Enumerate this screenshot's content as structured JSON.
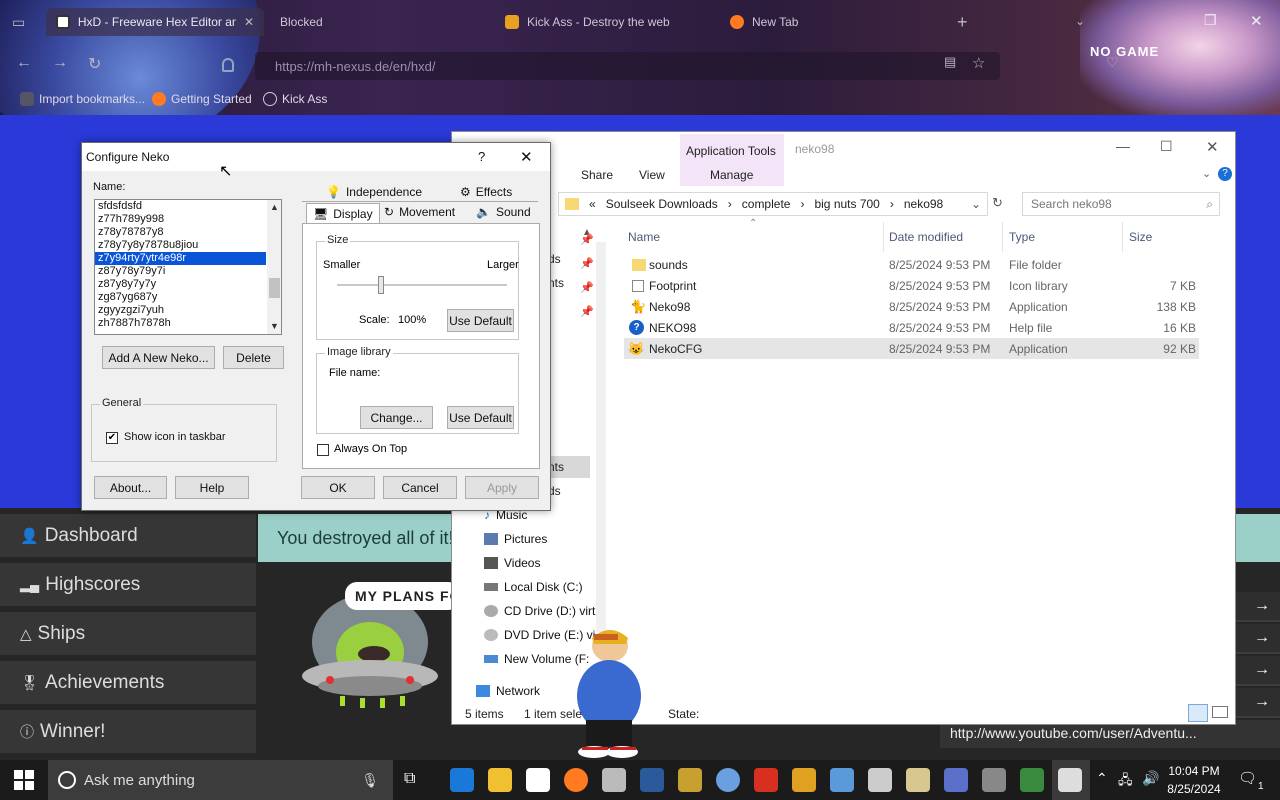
{
  "browser": {
    "tabs": [
      {
        "label": "HxD - Freeware Hex Editor and ..."
      },
      {
        "label": "Blocked"
      },
      {
        "label": "Kick Ass - Destroy the web"
      },
      {
        "label": "New Tab"
      }
    ],
    "url": "https://mh-nexus.de/en/hxd/",
    "bookmarks": [
      "Import bookmarks...",
      "Getting Started",
      "Kick Ass"
    ],
    "theme_text": "NO GAME"
  },
  "site": {
    "sidebar": [
      "Dashboard",
      "Highscores",
      "Ships",
      "Achievements",
      "Winner!"
    ],
    "banner": "You destroyed all of it!",
    "bubble": "MY PLANS FOR",
    "arrows": [
      "→",
      "→",
      "→",
      "→"
    ],
    "link": "http://www.youtube.com/user/Adventu..."
  },
  "explorer": {
    "title": "neko98",
    "ribbon": {
      "context_group": "Application Tools",
      "tabs": [
        "Share",
        "View",
        "Manage"
      ]
    },
    "breadcrumb": [
      "«",
      "Soulseek Downloads",
      "complete",
      "big nuts 700",
      "neko98"
    ],
    "search_placeholder": "Search neko98",
    "nav_partial": [
      "ds",
      "nts",
      "nts",
      "ds"
    ],
    "nav": [
      "Music",
      "Pictures",
      "Videos",
      "Local Disk (C:)",
      "CD Drive (D:) virt",
      "DVD Drive (E:) vi",
      "New Volume (F:",
      "Network"
    ],
    "columns": [
      "Name",
      "Date modified",
      "Type",
      "Size"
    ],
    "files": [
      {
        "name": "sounds",
        "date": "8/25/2024 9:53 PM",
        "type": "File folder",
        "size": ""
      },
      {
        "name": "Footprint",
        "date": "8/25/2024 9:53 PM",
        "type": "Icon library",
        "size": "7 KB"
      },
      {
        "name": "Neko98",
        "date": "8/25/2024 9:53 PM",
        "type": "Application",
        "size": "138 KB"
      },
      {
        "name": "NEKO98",
        "date": "8/25/2024 9:53 PM",
        "type": "Help file",
        "size": "16 KB"
      },
      {
        "name": "NekoCFG",
        "date": "8/25/2024 9:53 PM",
        "type": "Application",
        "size": "92 KB"
      }
    ],
    "status": {
      "items": "5 items",
      "selected": "1 item sele",
      "state": "State:"
    }
  },
  "neko": {
    "title": "Configure Neko",
    "help": "?",
    "name_label": "Name:",
    "list": [
      "sfdsfdsfd",
      "z77h789y998",
      "z78y78787y8",
      "z78y7y8y7878u8jiou",
      "z7y94rty7ytr4e98r",
      "z87y78y79y7i",
      "z87y8y7y7y",
      "zg87yg687y",
      "zgyyzgzi7yuh",
      "zh7887h7878h"
    ],
    "selected_index": 4,
    "add_button": "Add A New Neko...",
    "delete_button": "Delete",
    "general_label": "General",
    "show_icon_label": "Show icon in taskbar",
    "show_icon_checked": true,
    "tabs_back": [
      "Independence",
      "Effects"
    ],
    "tabs_front": [
      "Display",
      "Movement",
      "Sound"
    ],
    "size_label": "Size",
    "smaller": "Smaller",
    "larger": "Larger",
    "scale_label": "Scale:",
    "scale_value": "100%",
    "use_default": "Use Default",
    "image_library": "Image library",
    "file_name": "File name:",
    "change": "Change...",
    "always_on_top": "Always On Top",
    "buttons": [
      "About...",
      "Help",
      "OK",
      "Cancel",
      "Apply"
    ]
  },
  "taskbar": {
    "search": "Ask me anything",
    "time": "10:04 PM",
    "date": "8/25/2024",
    "notifications": "1"
  }
}
